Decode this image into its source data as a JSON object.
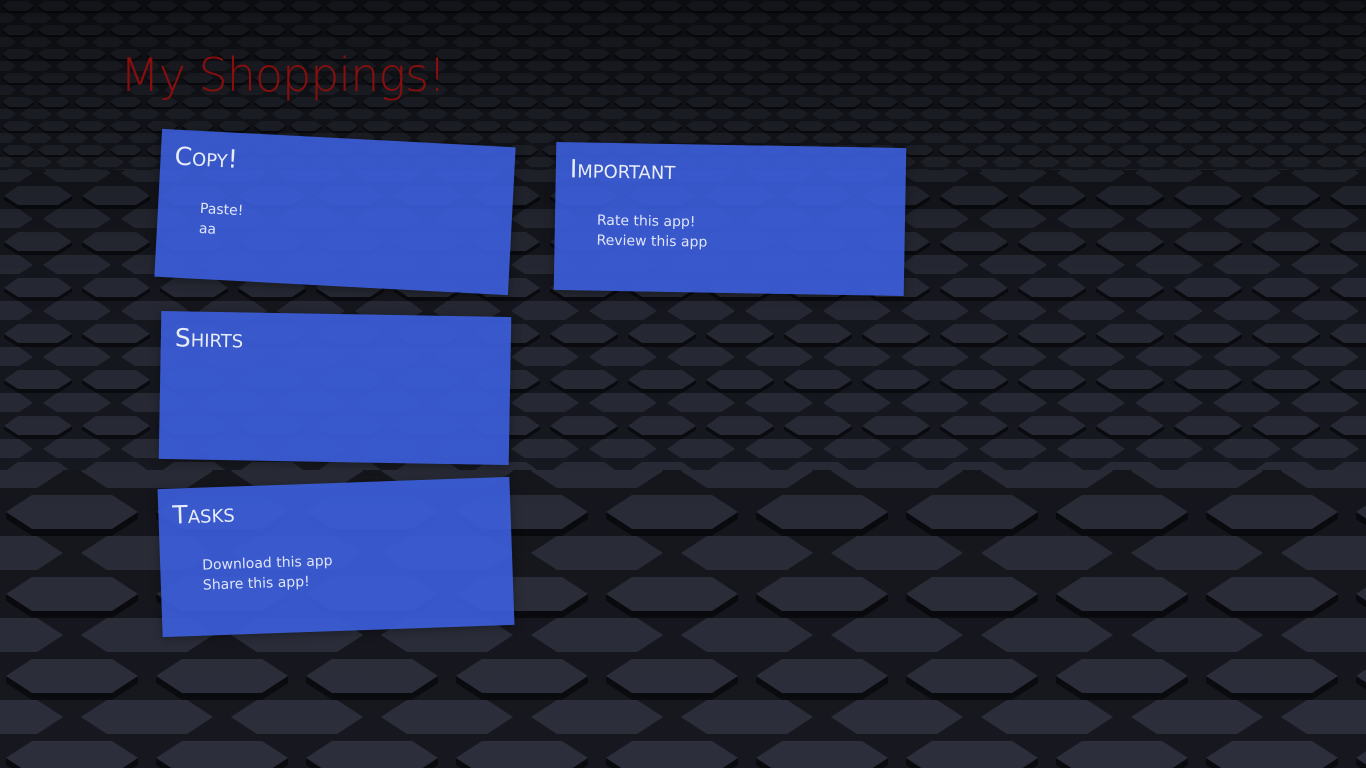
{
  "app": {
    "title": "My Shoppings!",
    "title_color": "#8b0e0e",
    "tile_color": "#3a5dd7",
    "background_color": "#15171e"
  },
  "lists": [
    {
      "title": "Copy!",
      "items": [
        "Paste!",
        "aa"
      ]
    },
    {
      "title": "Important",
      "items": [
        "Rate this app!",
        "Review this app"
      ]
    },
    {
      "title": "Shirts",
      "items": []
    },
    {
      "title": "Tasks",
      "items": [
        "Download this app",
        "Share this app!"
      ]
    }
  ]
}
